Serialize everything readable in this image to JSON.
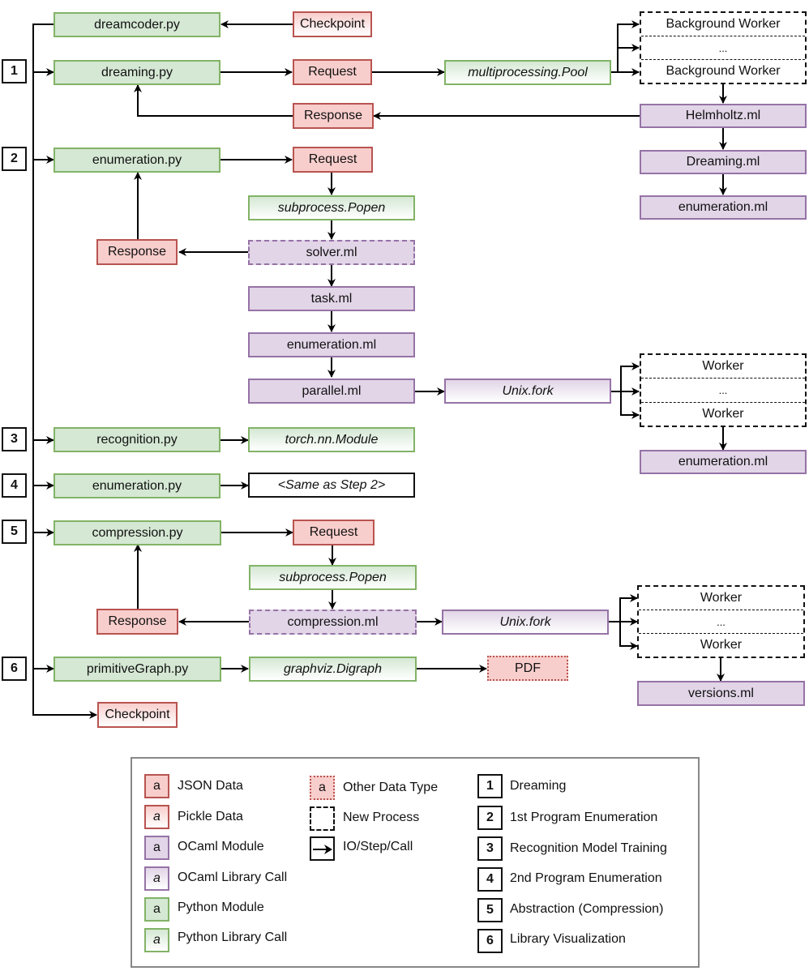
{
  "diagram": {
    "steps": [
      {
        "number": "1",
        "legend": "Dreaming"
      },
      {
        "number": "2",
        "legend": "1st Program Enumeration"
      },
      {
        "number": "3",
        "legend": "Recognition Model Training"
      },
      {
        "number": "4",
        "legend": "2nd Program Enumeration"
      },
      {
        "number": "5",
        "legend": "Abstraction (Compression)"
      },
      {
        "number": "6",
        "legend": "Library Visualization"
      }
    ],
    "nodes": {
      "dreamcoder_py": "dreamcoder.py",
      "checkpoint_in": "Checkpoint",
      "dreaming_py": "dreaming.py",
      "request_1": "Request",
      "mp_pool": "multiprocessing.Pool",
      "bg_worker_a": "Background Worker",
      "bg_worker_ellipsis": "...",
      "bg_worker_b": "Background Worker",
      "response_1": "Response",
      "helmholtz_ml": "Helmholtz.ml",
      "dreaming_ml": "Dreaming.ml",
      "enumeration_ml_1": "enumeration.ml",
      "enumeration_py_2": "enumeration.py",
      "request_2": "Request",
      "subprocess_popen_2": "subprocess.Popen",
      "response_2": "Response",
      "solver_ml": "solver.ml",
      "task_ml": "task.ml",
      "enumeration_ml_2": "enumeration.ml",
      "parallel_ml": "parallel.ml",
      "unix_fork_2": "Unix.fork",
      "worker_2a": "Worker",
      "worker_2_ellipsis": "...",
      "worker_2b": "Worker",
      "enumeration_ml_3": "enumeration.ml",
      "recognition_py": "recognition.py",
      "torch_module": "torch.nn.Module",
      "enumeration_py_4": "enumeration.py",
      "same_as_step2": "<Same as Step 2>",
      "compression_py": "compression.py",
      "request_5": "Request",
      "subprocess_popen_5": "subprocess.Popen",
      "response_5": "Response",
      "compression_ml": "compression.ml",
      "unix_fork_5": "Unix.fork",
      "worker_5a": "Worker",
      "worker_5_ellipsis": "...",
      "worker_5b": "Worker",
      "versions_ml": "versions.ml",
      "primitive_graph_py": "primitiveGraph.py",
      "graphviz_digraph": "graphviz.Digraph",
      "pdf": "PDF",
      "checkpoint_out": "Checkpoint"
    }
  },
  "legend": {
    "swatch_letter": "a",
    "types": [
      {
        "label": "JSON Data"
      },
      {
        "label": "Pickle Data"
      },
      {
        "label": "OCaml Module"
      },
      {
        "label": "OCaml Library Call"
      },
      {
        "label": "Python Module"
      },
      {
        "label": "Python Library Call"
      },
      {
        "label": "Other Data Type"
      },
      {
        "label": "New Process"
      },
      {
        "label": "IO/Step/Call"
      }
    ]
  }
}
